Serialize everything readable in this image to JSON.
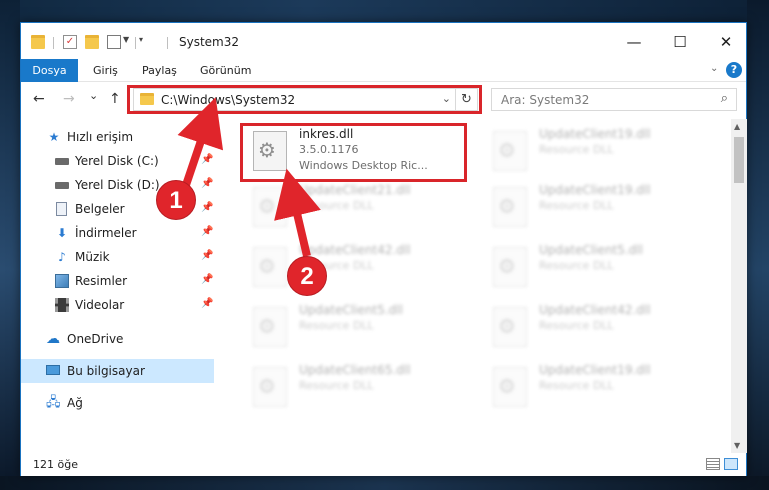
{
  "window": {
    "title": "System32",
    "minimize_glyph": "—",
    "maximize_glyph": "☐",
    "close_glyph": "✕"
  },
  "ribbon": {
    "tabs": [
      {
        "label": "Dosya"
      },
      {
        "label": "Giriş"
      },
      {
        "label": "Paylaş"
      },
      {
        "label": "Görünüm"
      }
    ],
    "help_label": "?"
  },
  "navbar": {
    "back_glyph": "←",
    "forward_glyph": "→",
    "recent_glyph": "⌄",
    "up_glyph": "↑",
    "address": "C:\\Windows\\System32",
    "refresh_glyph": "↻",
    "search_placeholder": "Ara: System32"
  },
  "sidebar": {
    "items": [
      {
        "label": "Hızlı erişim",
        "icon": "star-icon"
      },
      {
        "label": "Yerel Disk (C:)",
        "icon": "drive-icon",
        "pinned": true
      },
      {
        "label": "Yerel Disk (D:)",
        "icon": "drive-icon",
        "pinned": true
      },
      {
        "label": "Belgeler",
        "icon": "document-icon",
        "pinned": true
      },
      {
        "label": "İndirmeler",
        "icon": "download-icon",
        "pinned": true
      },
      {
        "label": "Müzik",
        "icon": "music-icon",
        "pinned": true
      },
      {
        "label": "Resimler",
        "icon": "pictures-icon",
        "pinned": true
      },
      {
        "label": "Videolar",
        "icon": "videos-icon",
        "pinned": true
      },
      {
        "label": "OneDrive",
        "icon": "cloud-icon"
      },
      {
        "label": "Bu bilgisayar",
        "icon": "computer-icon",
        "selected": true
      },
      {
        "label": "Ağ",
        "icon": "network-icon"
      }
    ]
  },
  "files": [
    {
      "name": "inkres.dll",
      "line2": "3.5.0.1176",
      "line3": "Windows Desktop Ric...",
      "highlighted": true
    },
    {
      "name": "UpdateClient19.dll",
      "line2": "Resource DLL"
    },
    {
      "name": "UpdateClient21.dll",
      "line2": "Resource DLL"
    },
    {
      "name": "UpdateClient19.dll",
      "line2": "Resource DLL"
    },
    {
      "name": "UpdateClient42.dll",
      "line2": "Resource DLL"
    },
    {
      "name": "UpdateClient5.dll",
      "line2": "Resource DLL"
    },
    {
      "name": "UpdateClient5.dll",
      "line2": "Resource DLL"
    },
    {
      "name": "UpdateClient42.dll",
      "line2": "Resource DLL"
    },
    {
      "name": "UpdateClient65.dll",
      "line2": "Resource DLL"
    },
    {
      "name": "UpdateClient19.dll",
      "line2": "Resource DLL"
    }
  ],
  "status": {
    "item_count": "121 öğe"
  },
  "annotations": {
    "marker1": "1",
    "marker2": "2",
    "color": "#e0252b"
  }
}
